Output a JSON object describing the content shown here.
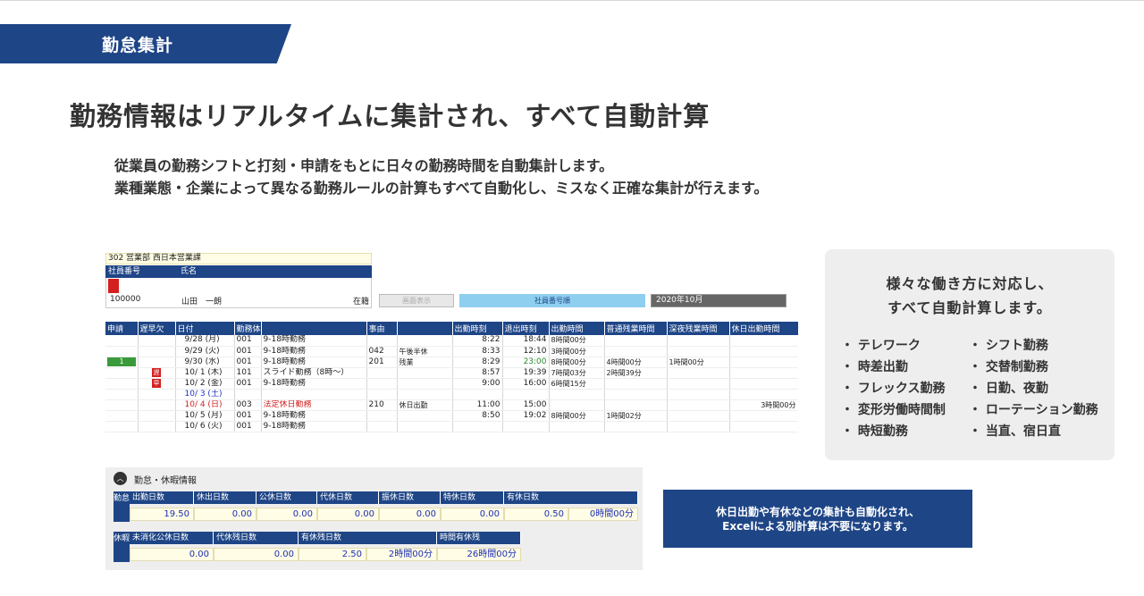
{
  "banner": {
    "title": "勤怠集計"
  },
  "headline": "勤務情報はリアルタイムに集計され、すべて自動計算",
  "intro": [
    "従業員の勤務シフトと打刻・申請をもとに日々の勤務時間を自動集計します。",
    "業種業態・企業によって異なる勤務ルールの計算もすべて自動化し、ミスなく正確な集計が行えます。"
  ],
  "screenshot_top": {
    "department": "302 営業部 西日本営業課",
    "employee_headers": [
      "社員番号",
      "氏名"
    ],
    "employee_number": "100000",
    "employee_name": "山田　一朗",
    "employee_status": "在籍",
    "display_button": "画面表示",
    "sort_button": "社員番号順",
    "month": "2020年10月",
    "table_headers": [
      "申請",
      "遅早欠",
      "日付",
      "勤務体系",
      "",
      "事由",
      "",
      "出勤時刻",
      "退出時刻",
      "出勤時間",
      "普通残業時間",
      "深夜残業時間",
      "休日出勤時間"
    ],
    "rows": [
      {
        "apply": "",
        "flag": "",
        "date": "9/28 (月)",
        "day_kind": "",
        "code": "001",
        "pattern": "9-18時勤務",
        "reason_code": "",
        "reason": "",
        "in": "8:22",
        "out": "18:44",
        "work": "8時間00分",
        "ot": "",
        "night": "",
        "holiday": ""
      },
      {
        "apply": "",
        "flag": "",
        "date": "9/29 (火)",
        "day_kind": "",
        "code": "001",
        "pattern": "9-18時勤務",
        "reason_code": "042",
        "reason": "午後半休",
        "in": "8:33",
        "out": "12:10",
        "work": "3時間00分",
        "ot": "",
        "night": "",
        "holiday": ""
      },
      {
        "apply": "1",
        "flag": "",
        "date": "9/30 (水)",
        "day_kind": "",
        "code": "001",
        "pattern": "9-18時勤務",
        "reason_code": "201",
        "reason": "残業",
        "in": "8:29",
        "out": "23:00",
        "work": "8時間00分",
        "ot": "4時間00分",
        "night": "1時間00分",
        "holiday": ""
      },
      {
        "apply": "",
        "flag": "遅",
        "date": "10/ 1 (木)",
        "day_kind": "",
        "code": "101",
        "pattern": "スライド勤務（8時～）",
        "reason_code": "",
        "reason": "",
        "in": "8:57",
        "out": "19:39",
        "work": "7時間03分",
        "ot": "2時間39分",
        "night": "",
        "holiday": ""
      },
      {
        "apply": "",
        "flag": "早",
        "date": "10/ 2 (金)",
        "day_kind": "",
        "code": "001",
        "pattern": "9-18時勤務",
        "reason_code": "",
        "reason": "",
        "in": "9:00",
        "out": "16:00",
        "work": "6時間15分",
        "ot": "",
        "night": "",
        "holiday": ""
      },
      {
        "apply": "",
        "flag": "",
        "date": "10/ 3 (土)",
        "day_kind": "sat",
        "code": "",
        "pattern": "",
        "reason_code": "",
        "reason": "",
        "in": "",
        "out": "",
        "work": "",
        "ot": "",
        "night": "",
        "holiday": ""
      },
      {
        "apply": "",
        "flag": "",
        "date": "10/ 4 (日)",
        "day_kind": "sun",
        "code": "003",
        "pattern": "法定休日勤務",
        "reason_code": "210",
        "reason": "休日出勤",
        "in": "11:00",
        "out": "15:00",
        "work": "",
        "ot": "",
        "night": "",
        "holiday": "3時間00分"
      },
      {
        "apply": "",
        "flag": "",
        "date": "10/ 5 (月)",
        "day_kind": "",
        "code": "001",
        "pattern": "9-18時勤務",
        "reason_code": "",
        "reason": "",
        "in": "8:50",
        "out": "19:02",
        "work": "8時間00分",
        "ot": "1時間02分",
        "night": "",
        "holiday": ""
      },
      {
        "apply": "",
        "flag": "",
        "date": "10/ 6 (火)",
        "day_kind": "",
        "code": "001",
        "pattern": "9-18時勤務",
        "reason_code": "",
        "reason": "",
        "in": "",
        "out": "",
        "work": "",
        "ot": "",
        "night": "",
        "holiday": ""
      }
    ]
  },
  "sidebox": {
    "title_line1": "様々な働き方に対応し、",
    "title_line2": "すべて自動計算します。",
    "left_items": [
      "・ テレワーク",
      "・ 時差出勤",
      "・ フレックス勤務",
      "・ 変形労働時間制",
      "・ 時短勤務"
    ],
    "right_items": [
      "・ シフト勤務",
      "・ 交替制勤務",
      "・ 日勤、夜勤",
      "・ ローテーション勤務",
      "・ 当直、宿日直"
    ]
  },
  "screenshot_bottom": {
    "section_icon": "chevron-up-icon",
    "section_title": "勤怠・休暇情報",
    "attendance_label": "勤怠",
    "attendance_headers": [
      "出勤日数",
      "休出日数",
      "公休日数",
      "代休日数",
      "振休日数",
      "特休日数",
      "有休日数"
    ],
    "attendance_values": [
      "19.50",
      "0.00",
      "0.00",
      "0.00",
      "0.00",
      "0.00",
      "0.50",
      "0時間00分"
    ],
    "leave_label": "休暇",
    "leave_headers": [
      "未消化公休日数",
      "代休残日数",
      "有休残日数",
      "時間有休残"
    ],
    "leave_values": [
      "0.00",
      "0.00",
      "2.50",
      "2時間00分",
      "26時間00分"
    ]
  },
  "note": {
    "line1": "休日出勤や有休などの集計も自動化され、",
    "line2": "Excelによる別計算は不要になります。"
  },
  "colors": {
    "brand_navy": "#1e4586",
    "light_blue": "#8ecfef",
    "alert_red": "#d42020",
    "green": "#3a9a3a"
  }
}
